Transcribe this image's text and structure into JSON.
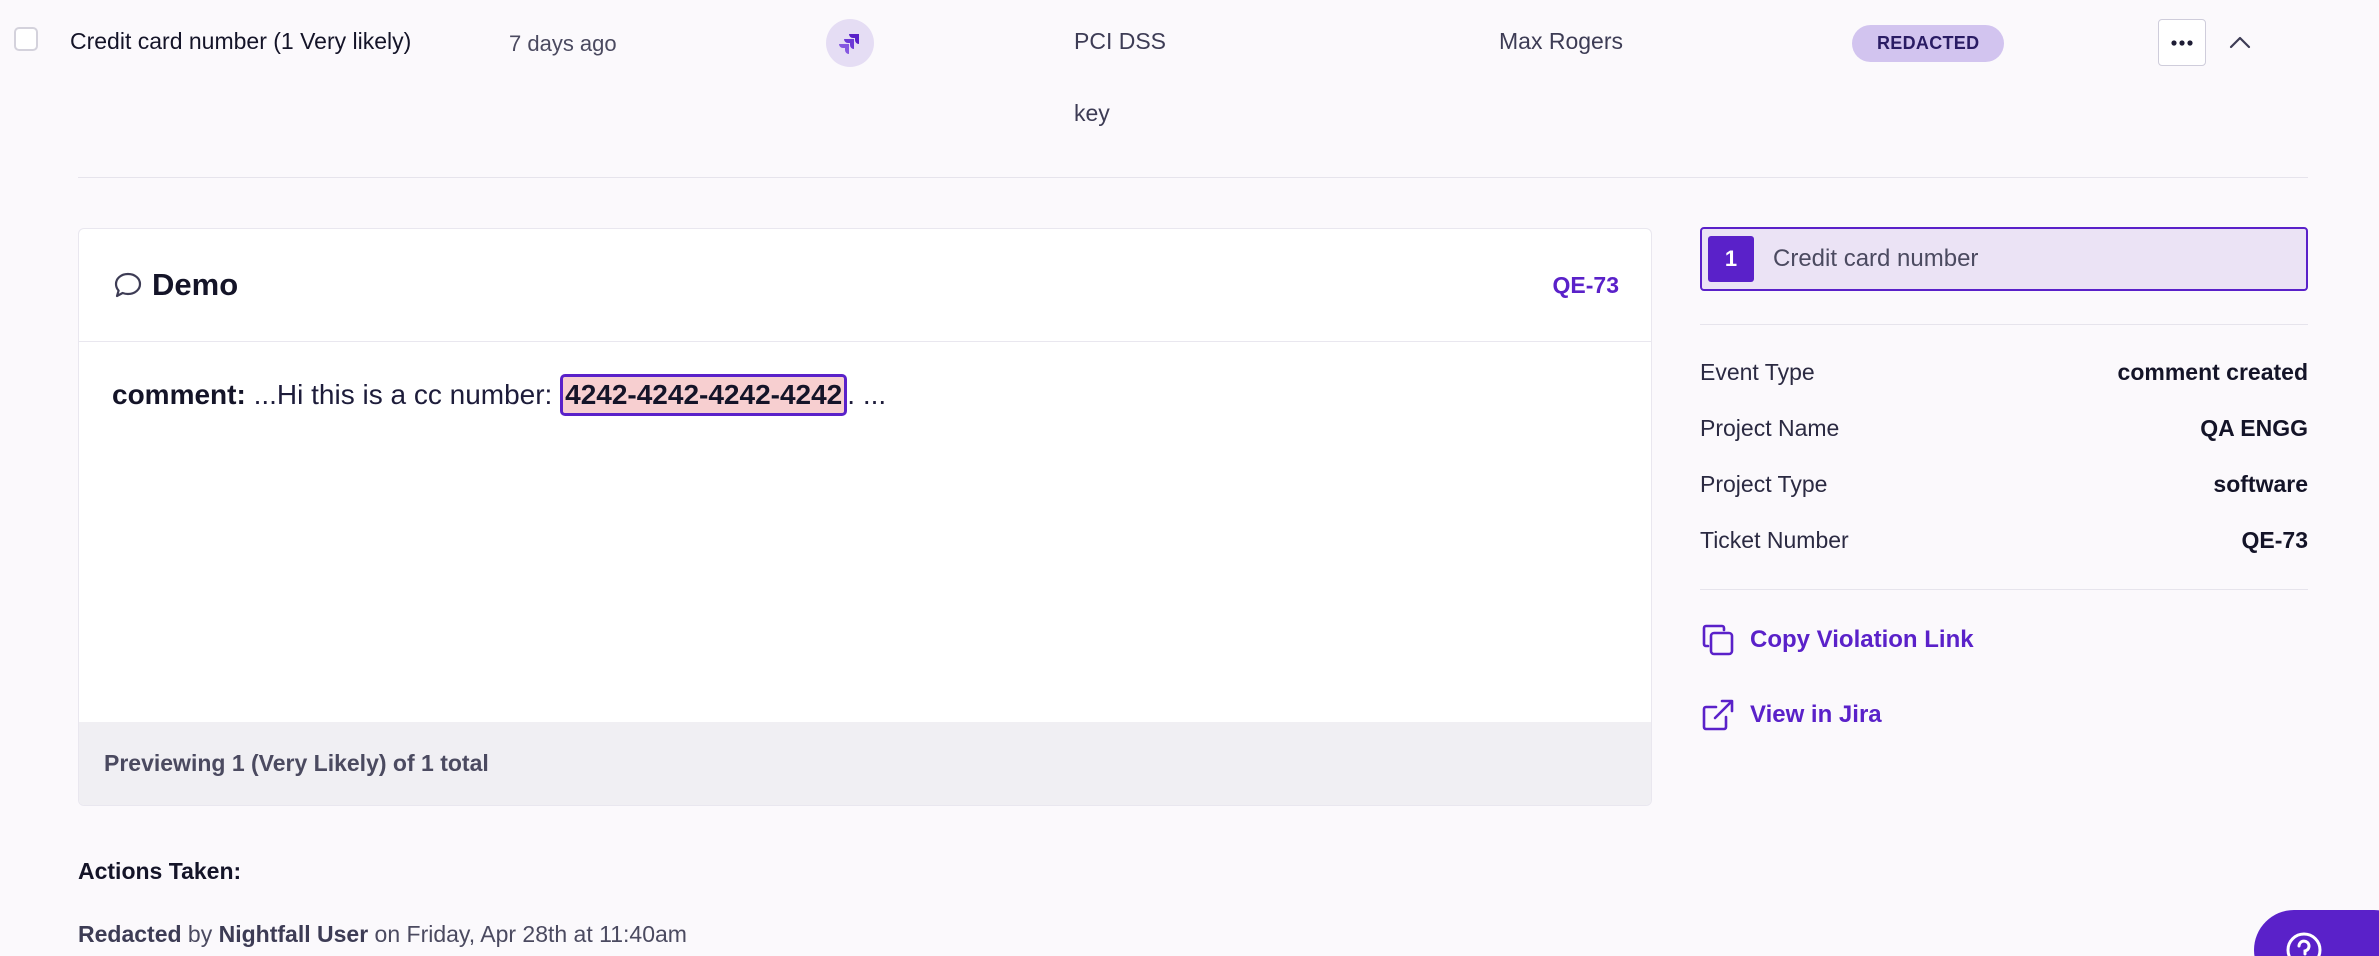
{
  "row": {
    "title": "Credit card number (1 Very likely)",
    "date": "7 days ago",
    "integration_icon": "jira-icon",
    "policy": "PCI DSS",
    "policy_extra": "key",
    "user": "Max Rogers",
    "status": "REDACTED",
    "more_icon": "more-horizontal-icon",
    "collapse_icon": "chevron-up-icon"
  },
  "preview": {
    "title_icon": "comment-icon",
    "title": "Demo",
    "ticket": "QE-73",
    "label": "comment:",
    "prefix": " ...Hi this is a cc number: ",
    "highlight": "4242-4242-4242-4242",
    "suffix": ". ...",
    "footer": "Previewing 1 (Very Likely) of 1 total"
  },
  "panel": {
    "finding_number": "1",
    "finding_label": "Credit card number",
    "meta": [
      {
        "key": "Event Type",
        "value": "comment created"
      },
      {
        "key": "Project Name",
        "value": "QA ENGG"
      },
      {
        "key": "Project Type",
        "value": "software"
      },
      {
        "key": "Ticket Number",
        "value": "QE-73"
      }
    ],
    "copy_link": "Copy Violation Link",
    "copy_icon": "copy-icon",
    "view_link": "View in Jira",
    "view_icon": "external-link-icon"
  },
  "actions": {
    "heading": "Actions Taken:",
    "action": "Redacted",
    "by": " by ",
    "actor": "Nightfall User",
    "when": " on Friday, Apr 28th at 11:40am"
  },
  "support": {
    "icon": "help-icon"
  },
  "colors": {
    "accent": "#5a21c9",
    "badge_bg": "#d2c4ef",
    "highlight_bg": "#f7cfd0",
    "background": "#fbf9fc"
  }
}
